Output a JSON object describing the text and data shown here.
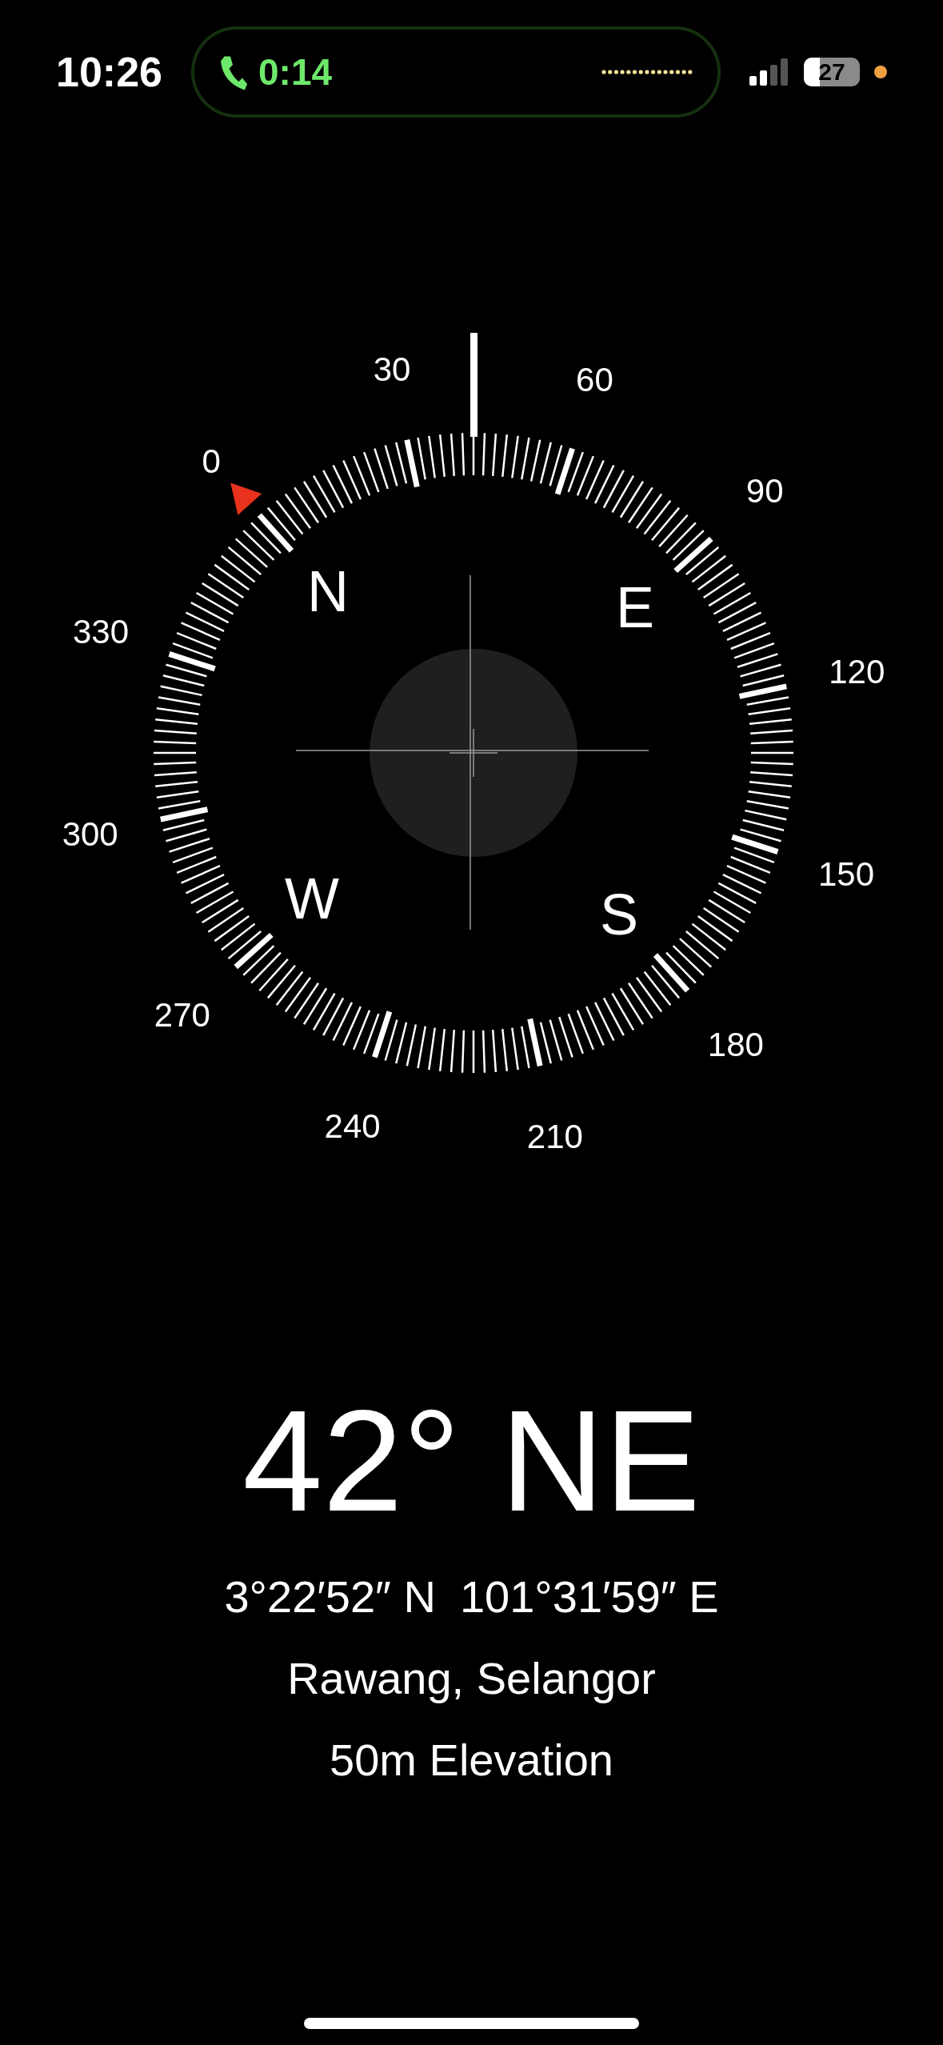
{
  "status_bar": {
    "time": "10:26",
    "call_duration": "0:14",
    "battery": "27"
  },
  "compass": {
    "dial_labels": [
      "0",
      "30",
      "60",
      "90",
      "120",
      "150",
      "180",
      "210",
      "240",
      "270",
      "300",
      "330"
    ],
    "cardinals": [
      "N",
      "E",
      "W",
      "S"
    ]
  },
  "heading": "42° NE",
  "coordinates": [
    "3°22′52″ N",
    "101°31′59″ E"
  ],
  "location": "Rawang, Selangor",
  "elevation": "50m Elevation"
}
